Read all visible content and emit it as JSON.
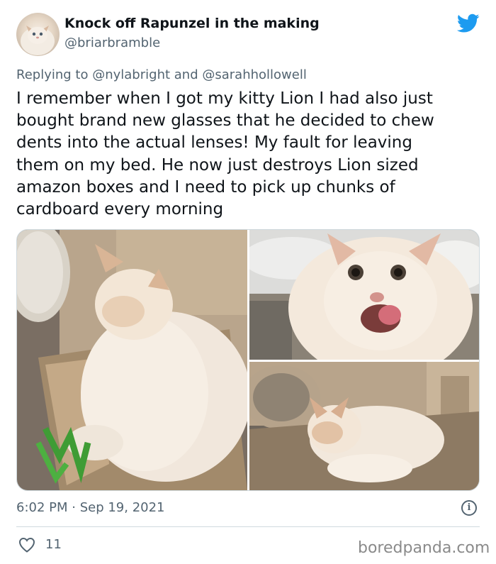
{
  "author": {
    "display_name": "Knock off Rapunzel in the making",
    "handle": "@briarbramble",
    "avatar_icon": "cat-avatar"
  },
  "brand_icon": "twitter-bird-icon",
  "brand_color": "#1d9bf0",
  "reply": {
    "prefix": "Replying to",
    "mention_1": "@nylabright",
    "joiner": "and",
    "mention_2": "@sarahhollowell"
  },
  "tweet": {
    "lines": [
      "I remember when I got my kitty Lion I had also just",
      "bought brand new glasses that he decided to chew",
      "dents into the actual lenses! My fault for leaving",
      "them on my bed. He now just destroys Lion sized",
      "amazon boxes and I need to pick up chunks of",
      "cardboard every morning"
    ]
  },
  "media": [
    {
      "name": "photo-cat-sleeping-in-box"
    },
    {
      "name": "photo-cat-licking-lips"
    },
    {
      "name": "photo-cat-lying-in-box"
    }
  ],
  "meta": {
    "timestamp": "6:02 PM · Sep 19, 2021",
    "info_glyph": "i",
    "likes": "11"
  },
  "watermark": "boredpanda.com"
}
